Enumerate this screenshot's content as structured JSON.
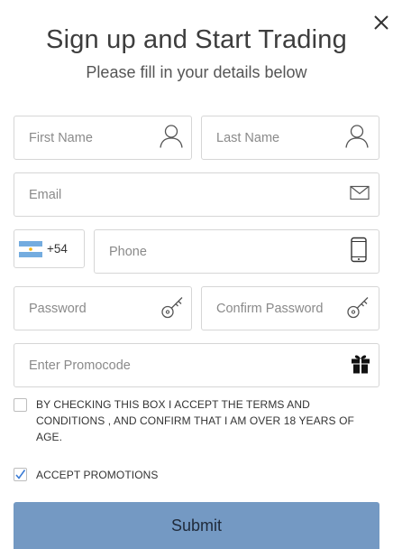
{
  "header": {
    "title": "Sign up and Start Trading",
    "subtitle": "Please fill in your details below"
  },
  "form": {
    "first_name": {
      "placeholder": "First Name",
      "icon": "user-icon"
    },
    "last_name": {
      "placeholder": "Last Name",
      "icon": "user-icon"
    },
    "email": {
      "placeholder": "Email",
      "icon": "envelope-icon"
    },
    "country": {
      "code": "+54",
      "flag": "argentina-flag-icon"
    },
    "phone": {
      "placeholder": "Phone",
      "icon": "mobile-phone-icon"
    },
    "password": {
      "placeholder": "Password",
      "icon": "key-icon"
    },
    "confirm_password": {
      "placeholder": "Confirm Password",
      "icon": "key-icon"
    },
    "promocode": {
      "placeholder": "Enter Promocode",
      "icon": "gift-icon"
    }
  },
  "consents": {
    "terms": {
      "label": "BY CHECKING THIS BOX I ACCEPT THE TERMS AND CONDITIONS , AND CONFIRM THAT I AM OVER 18 YEARS OF AGE.",
      "checked": false
    },
    "promotions": {
      "label": "ACCEPT PROMOTIONS",
      "checked": true
    }
  },
  "submit_label": "Submit",
  "colors": {
    "accent": "#7499c3",
    "border": "#d6d6d6",
    "check": "#3a7bd5"
  }
}
